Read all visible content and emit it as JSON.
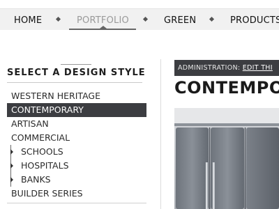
{
  "nav": {
    "items": [
      {
        "label": "HOME"
      },
      {
        "label": "PORTFOLIO",
        "active": true
      },
      {
        "label": "GREEN"
      },
      {
        "label": "PRODUCTS"
      }
    ]
  },
  "sidebar": {
    "title": "SELECT A DESIGN STYLE",
    "items": [
      {
        "label": "WESTERN HERITAGE"
      },
      {
        "label": "CONTEMPORARY",
        "selected": true
      },
      {
        "label": "ARTISAN"
      },
      {
        "label": "COMMERCIAL"
      },
      {
        "label": "SCHOOLS",
        "sub": true
      },
      {
        "label": "HOSPITALS",
        "sub": true
      },
      {
        "label": "BANKS",
        "sub": true
      },
      {
        "label": "BUILDER SERIES"
      }
    ]
  },
  "main": {
    "admin_label": "ADMINISTRATION:",
    "admin_link": "EDIT THI",
    "page_title": "CONTEMPO"
  },
  "colors": {
    "nav_bg": "#f1f1f1",
    "selected_bg": "#3c3d41",
    "admin_bg": "#3c3d41"
  }
}
